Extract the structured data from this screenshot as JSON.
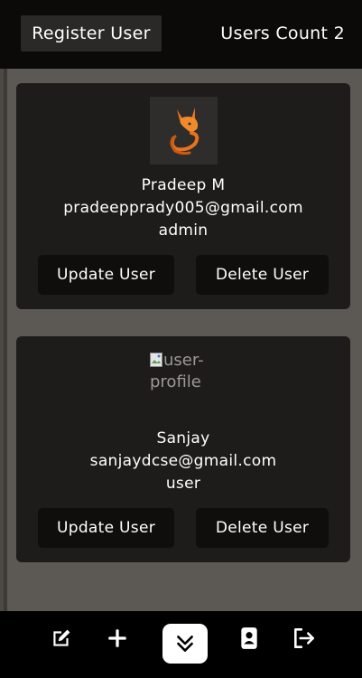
{
  "header": {
    "register_label": "Register User",
    "users_count_label": "Users Count 2"
  },
  "users": [
    {
      "name": "Pradeep M",
      "email": "pradeepprady005@gmail.com",
      "role": "admin",
      "avatar": "fox-logo-image",
      "update_label": "Update User",
      "delete_label": "Delete User"
    },
    {
      "name": "Sanjay",
      "email": "sanjaydcse@gmail.com",
      "role": "user",
      "avatar_alt": "user-profile",
      "update_label": "Update User",
      "delete_label": "Delete User"
    }
  ],
  "bottom_nav": {
    "items": [
      "edit-icon",
      "plus-icon",
      "chevron-double-down-icon",
      "contact-icon",
      "logout-icon"
    ]
  },
  "colors": {
    "topbar": "#0b0a09",
    "content_bg": "#5c5954",
    "card_bg": "#1e1c1a",
    "button_bg": "#0f0e0d",
    "accent_orange": "#e8731d"
  }
}
